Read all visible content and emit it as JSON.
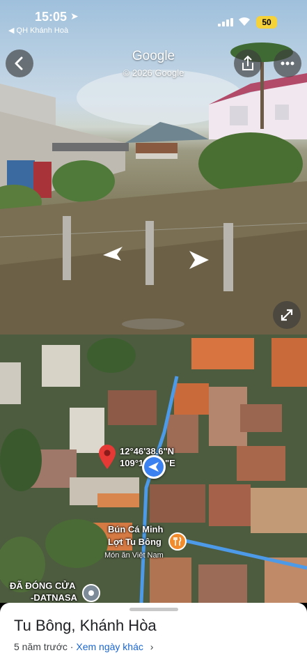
{
  "status": {
    "time": "15:05",
    "back_app": "◀ QH Khánh Hoà",
    "battery": "50"
  },
  "street_view": {
    "brand": "Google",
    "copyright": "© 2026 Google"
  },
  "map": {
    "coordinates_line1": "12°46'38.6\"N",
    "coordinates_line2": "109°1",
    "coordinates_line2_end": "\"E",
    "poi_name_line1": "Bún Cá Minh",
    "poi_name_line2": "Lợt Tu Bông",
    "poi_category": "Món ăn Việt Nam",
    "closed_label_line1": "ĐÃ ĐÓNG CỬA",
    "closed_label_line2": "-DATNASA"
  },
  "sheet": {
    "place_name": "Tu Bông, Khánh Hòa",
    "age": "5 năm trước · ",
    "other_dates": "Xem ngày khác",
    "chevron": "›"
  }
}
